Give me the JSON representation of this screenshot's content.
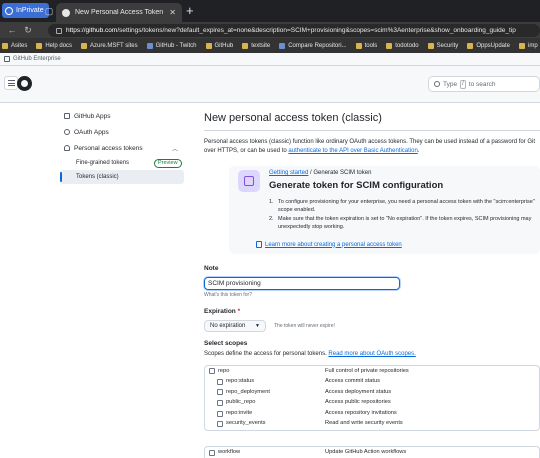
{
  "browser": {
    "inprivate_label": "InPrivate",
    "tab_title": "New Personal Access Token (Clas",
    "url_host": "https://github.com",
    "url_path": "/settings/tokens/new?default_expires_at=none&description=SCIM+provisioning&scopes=scim%3Aenterprise&show_onboarding_guide_tip",
    "favorites": [
      {
        "label": "Asites",
        "icon": "folder-icon"
      },
      {
        "label": "Help docs",
        "icon": "folder-icon"
      },
      {
        "label": "Azure.MSFT sites",
        "icon": "folder-icon"
      },
      {
        "label": "GitHub - Twitch",
        "icon": "github-icon"
      },
      {
        "label": "GitHub",
        "icon": "folder-icon"
      },
      {
        "label": "textsite",
        "icon": "folder-icon"
      },
      {
        "label": "Compare Repositori...",
        "icon": "github-icon"
      },
      {
        "label": "tools",
        "icon": "folder-icon"
      },
      {
        "label": "todotodo",
        "icon": "folder-icon"
      },
      {
        "label": "Security",
        "icon": "folder-icon"
      },
      {
        "label": "OppsUpdate",
        "icon": "folder-icon"
      },
      {
        "label": "imp",
        "icon": "folder-icon"
      }
    ]
  },
  "enterprise_banner": "GitHub Enterprise",
  "header": {
    "search_prefix": "Type",
    "search_key": "/",
    "search_suffix": "to search"
  },
  "sidebar": {
    "github_apps": "GitHub Apps",
    "oauth_apps": "OAuth Apps",
    "pat": "Personal access tokens",
    "fine_grained": "Fine-grained tokens",
    "preview_badge": "Preview",
    "classic": "Tokens (classic)"
  },
  "main": {
    "title": "New personal access token (classic)",
    "intro_line1": "Personal access tokens (classic) function like ordinary OAuth access tokens. They can be used instead of a password for Git",
    "intro_line2_prefix": "over HTTPS, or can be used to",
    "intro_link": "authenticate to the API over Basic Authentication",
    "intro_suffix": "."
  },
  "callout": {
    "crumb_link": "Getting started",
    "crumb_sep": "/",
    "crumb_current": "Generate SCIM token",
    "title": "Generate token for SCIM configuration",
    "steps": [
      {
        "num": "1.",
        "text": "To configure provisioning for your enterprise, you need a personal access token with the \"scim:enterprise\" scope enabled."
      },
      {
        "num": "2.",
        "text": "Make sure that the token expiration is set to \"No expiration\". If the token expires, SCIM provisioning may unexpectedly stop working."
      }
    ],
    "learn_more": "Learn more about creating a personal access token"
  },
  "form": {
    "note_label": "Note",
    "note_value": "SCIM provisioning",
    "note_helper": "What's this token for?",
    "expiration_label": "Expiration",
    "required_mark": "*",
    "expiration_value": "No expiration",
    "expiration_helper": "The token will never expire!",
    "scopes_label": "Select scopes",
    "scopes_desc_prefix": "Scopes define the access for personal tokens.",
    "scopes_link": "Read more about OAuth scopes."
  },
  "scopes": [
    {
      "name": "repo",
      "desc": "Full control of private repositories",
      "level": "top",
      "checked": false
    },
    {
      "name": "repo:status",
      "desc": "Access commit status",
      "level": "sub",
      "checked": false
    },
    {
      "name": "repo_deployment",
      "desc": "Access deployment status",
      "level": "sub",
      "checked": false
    },
    {
      "name": "public_repo",
      "desc": "Access public repositories",
      "level": "sub",
      "checked": false
    },
    {
      "name": "repo:invite",
      "desc": "Access repository invitations",
      "level": "sub",
      "checked": false
    },
    {
      "name": "security_events",
      "desc": "Read and write security events",
      "level": "sub",
      "checked": false
    }
  ],
  "workflow_scope": {
    "name": "workflow",
    "desc": "Update GitHub Action workflows",
    "checked": false
  }
}
